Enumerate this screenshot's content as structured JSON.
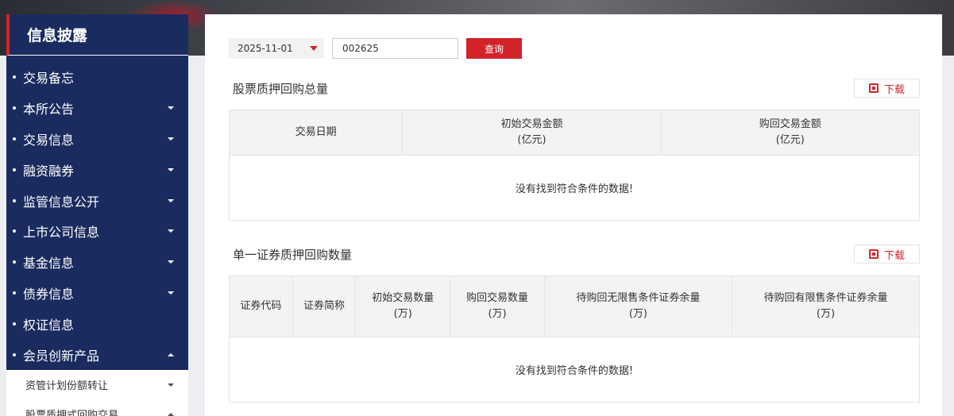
{
  "sidebar": {
    "title": "信息披露",
    "items": [
      {
        "label": "交易备忘",
        "has_caret": false
      },
      {
        "label": "本所公告",
        "has_caret": true
      },
      {
        "label": "交易信息",
        "has_caret": true
      },
      {
        "label": "融资融券",
        "has_caret": true
      },
      {
        "label": "监管信息公开",
        "has_caret": true
      },
      {
        "label": "上市公司信息",
        "has_caret": true
      },
      {
        "label": "基金信息",
        "has_caret": true
      },
      {
        "label": "债券信息",
        "has_caret": true
      },
      {
        "label": "权证信息",
        "has_caret": false
      },
      {
        "label": "会员创新产品",
        "has_caret": true,
        "expanded": true
      }
    ],
    "sub_items": [
      {
        "label": "资管计划份额转让"
      },
      {
        "label": "股票质押式回购交易"
      }
    ]
  },
  "toolbar": {
    "date_value": "2025-11-01",
    "code_value": "002625",
    "query_label": "查询"
  },
  "section1": {
    "title": "股票质押回购总量",
    "download_label": "下载",
    "columns": [
      "交易日期",
      "初始交易金额\n(亿元)",
      "购回交易金额\n(亿元)"
    ],
    "empty_text": "没有找到符合条件的数据!"
  },
  "section2": {
    "title": "单一证券质押回购数量",
    "download_label": "下载",
    "columns": [
      "证券代码",
      "证券简称",
      "初始交易数量\n(万)",
      "购回交易数量\n(万)",
      "待购回无限售条件证券余量\n(万)",
      "待购回有限售条件证券余量\n(万)"
    ],
    "empty_text": "没有找到符合条件的数据!"
  },
  "colors": {
    "navy": "#1a2b5f",
    "accent": "#d2232a"
  }
}
